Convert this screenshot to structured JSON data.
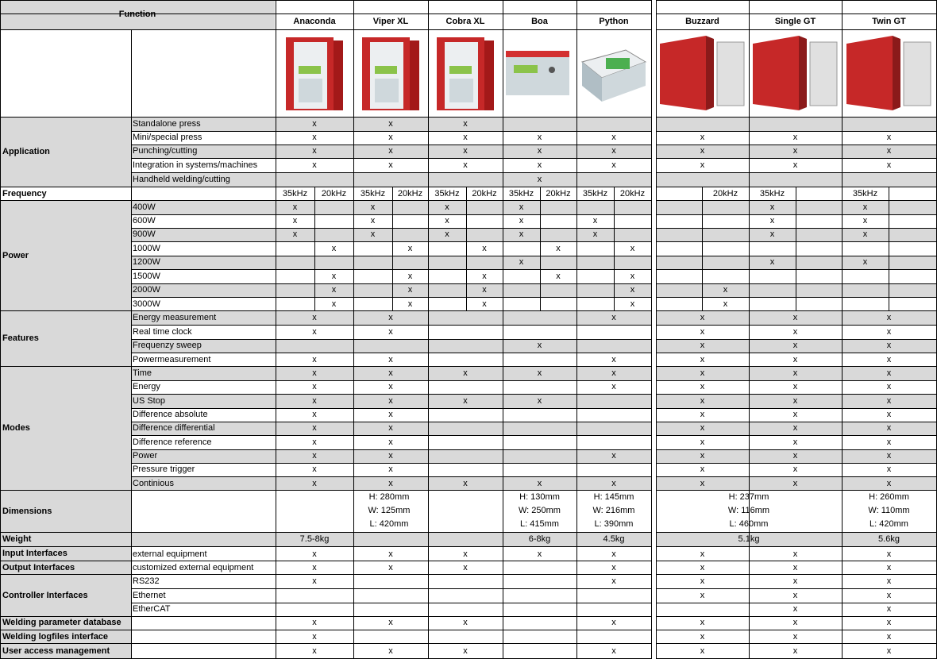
{
  "header": {
    "function_label": "Function"
  },
  "products": [
    "Anaconda",
    "Viper XL",
    "Cobra XL",
    "Boa",
    "Python",
    "Buzzard",
    "Single GT",
    "Twin GT"
  ],
  "groups": {
    "application": "Application",
    "frequency": "Frequency",
    "power": "Power",
    "features": "Features",
    "modes": "Modes",
    "dimensions": "Dimensions",
    "weight": "Weight",
    "input_interfaces": "Input Interfaces",
    "output_interfaces": "Output Interfaces",
    "controller_interfaces": "Controller Interfaces",
    "welding_db": "Welding parameter database",
    "welding_log": "Welding logfiles interface",
    "user_access": "User access management"
  },
  "rows": [
    {
      "label": "Standalone press",
      "shade": true,
      "marks": [
        "x",
        "x",
        "x",
        "",
        "",
        "",
        "",
        ""
      ]
    },
    {
      "label": "Mini/special press",
      "shade": false,
      "marks": [
        "x",
        "x",
        "x",
        "x",
        "x",
        "x",
        "x",
        "x"
      ]
    },
    {
      "label": "Punching/cutting",
      "shade": true,
      "marks": [
        "x",
        "x",
        "x",
        "x",
        "x",
        "x",
        "x",
        "x"
      ]
    },
    {
      "label": "Integration in systems/machines",
      "shade": false,
      "marks": [
        "x",
        "x",
        "x",
        "x",
        "x",
        "x",
        "x",
        "x"
      ]
    },
    {
      "label": "Handheld welding/cutting",
      "shade": true,
      "marks": [
        "",
        "",
        "",
        "x",
        "",
        "",
        "",
        ""
      ]
    },
    {
      "label": "400W",
      "shade": true,
      "marks": [
        "x",
        "",
        "x",
        "",
        "x",
        "",
        "x",
        "",
        "",
        "",
        "",
        "",
        "x",
        "",
        "x",
        ""
      ],
      "freq": true
    },
    {
      "label": "600W",
      "shade": false,
      "marks": [
        "x",
        "",
        "x",
        "",
        "x",
        "",
        "x",
        "",
        "x",
        "",
        "",
        "",
        "x",
        "",
        "x",
        ""
      ],
      "freq": true
    },
    {
      "label": "900W",
      "shade": true,
      "marks": [
        "x",
        "",
        "x",
        "",
        "x",
        "",
        "x",
        "",
        "x",
        "",
        "",
        "",
        "x",
        "",
        "x",
        ""
      ],
      "freq": true
    },
    {
      "label": "1000W",
      "shade": false,
      "marks": [
        "",
        "x",
        "",
        "x",
        "",
        "x",
        "",
        "x",
        "",
        "x",
        "",
        "",
        "",
        "",
        "",
        ""
      ],
      "freq": true
    },
    {
      "label": "1200W",
      "shade": true,
      "marks": [
        "",
        "",
        "",
        "",
        "",
        "",
        "x",
        "",
        "",
        "",
        "",
        "",
        "x",
        "",
        "x",
        ""
      ],
      "freq": true
    },
    {
      "label": "1500W",
      "shade": false,
      "marks": [
        "",
        "x",
        "",
        "x",
        "",
        "x",
        "",
        "x",
        "",
        "x",
        "",
        "",
        "",
        "",
        "",
        ""
      ],
      "freq": true
    },
    {
      "label": "2000W",
      "shade": true,
      "marks": [
        "",
        "x",
        "",
        "x",
        "",
        "x",
        "",
        "",
        "",
        "x",
        "",
        "x",
        "",
        "",
        "",
        ""
      ],
      "freq": true
    },
    {
      "label": "3000W",
      "shade": false,
      "marks": [
        "",
        "x",
        "",
        "x",
        "",
        "x",
        "",
        "",
        "",
        "x",
        "",
        "x",
        "",
        "",
        "",
        ""
      ],
      "freq": true
    },
    {
      "label": "Energy measurement",
      "shade": true,
      "marks": [
        "x",
        "x",
        "",
        "",
        "x",
        "x",
        "x",
        "x"
      ]
    },
    {
      "label": "Real time clock",
      "shade": false,
      "marks": [
        "x",
        "x",
        "",
        "",
        "",
        "x",
        "x",
        "x"
      ]
    },
    {
      "label": "Frequenzy sweep",
      "shade": true,
      "marks": [
        "",
        "",
        "",
        "x",
        "",
        "x",
        "x",
        "x"
      ]
    },
    {
      "label": "Powermeasurement",
      "shade": false,
      "marks": [
        "x",
        "x",
        "",
        "",
        "x",
        "x",
        "x",
        "x"
      ]
    },
    {
      "label": "Time",
      "shade": true,
      "marks": [
        "x",
        "x",
        "x",
        "x",
        "x",
        "x",
        "x",
        "x"
      ]
    },
    {
      "label": "Energy",
      "shade": false,
      "marks": [
        "x",
        "x",
        "",
        "",
        "x",
        "x",
        "x",
        "x"
      ]
    },
    {
      "label": "US Stop",
      "shade": true,
      "marks": [
        "x",
        "x",
        "x",
        "x",
        "",
        "x",
        "x",
        "x"
      ]
    },
    {
      "label": "Difference absolute",
      "shade": false,
      "marks": [
        "x",
        "x",
        "",
        "",
        "",
        "x",
        "x",
        "x"
      ]
    },
    {
      "label": "Difference differential",
      "shade": true,
      "marks": [
        "x",
        "x",
        "",
        "",
        "",
        "x",
        "x",
        "x"
      ]
    },
    {
      "label": "Difference reference",
      "shade": false,
      "marks": [
        "x",
        "x",
        "",
        "",
        "",
        "x",
        "x",
        "x"
      ]
    },
    {
      "label": "Power",
      "shade": true,
      "marks": [
        "x",
        "x",
        "",
        "",
        "x",
        "x",
        "x",
        "x"
      ]
    },
    {
      "label": "Pressure trigger",
      "shade": false,
      "marks": [
        "x",
        "x",
        "",
        "",
        "",
        "x",
        "x",
        "x"
      ]
    },
    {
      "label": "Continious",
      "shade": true,
      "marks": [
        "x",
        "x",
        "x",
        "x",
        "x",
        "x",
        "x",
        "x"
      ]
    },
    {
      "label": "external equipment",
      "shade": false,
      "marks": [
        "x",
        "x",
        "x",
        "x",
        "x",
        "x",
        "x",
        "x"
      ]
    },
    {
      "label": "customized external equipment",
      "shade": false,
      "marks": [
        "x",
        "x",
        "x",
        "",
        "x",
        "x",
        "x",
        "x"
      ]
    },
    {
      "label": "RS232",
      "shade": false,
      "marks": [
        "x",
        "",
        "",
        "",
        "x",
        "x",
        "x",
        "x"
      ]
    },
    {
      "label": "Ethernet",
      "shade": false,
      "marks": [
        "",
        "",
        "",
        "",
        "",
        "x",
        "x",
        "x"
      ]
    },
    {
      "label": "EtherCAT",
      "shade": false,
      "marks": [
        "",
        "",
        "",
        "",
        "",
        "",
        "x",
        "x"
      ]
    },
    {
      "label": "",
      "shade": false,
      "marks": [
        "x",
        "x",
        "x",
        "",
        "x",
        "x",
        "x",
        "x"
      ]
    },
    {
      "label": "",
      "shade": false,
      "marks": [
        "x",
        "",
        "",
        "",
        "",
        "x",
        "x",
        "x"
      ]
    },
    {
      "label": "",
      "shade": false,
      "marks": [
        "x",
        "x",
        "x",
        "",
        "x",
        "x",
        "x",
        "x"
      ]
    }
  ],
  "frequency_values": [
    "35kHz",
    "20kHz",
    "35kHz",
    "20kHz",
    "35kHz",
    "20kHz",
    "35kHz",
    "20kHz",
    "35kHz",
    "20kHz",
    "",
    "20kHz",
    "35kHz",
    "",
    "35kHz",
    ""
  ],
  "dimensions": [
    {
      "h": "H: 280mm",
      "w": "W: 125mm",
      "l": "L: 420mm"
    },
    {
      "h": "H: 130mm",
      "w": "W: 250mm",
      "l": "L: 415mm"
    },
    {
      "h": "H: 145mm",
      "w": "W: 216mm",
      "l": "L: 390mm"
    },
    {
      "h": "H: 237mm",
      "w": "W: 116mm",
      "l": "L: 460mm"
    },
    {
      "h": "H: 260mm",
      "w": "W: 110mm",
      "l": "L: 420mm"
    }
  ],
  "weights": [
    "7.5-8kg",
    "6-8kg",
    "4.5kg",
    "5.1kg",
    "5.6kg"
  ],
  "colors": {
    "shade": "#d9d9d9",
    "device_red": "#d32f2f",
    "device_grey": "#b0b0b0"
  }
}
